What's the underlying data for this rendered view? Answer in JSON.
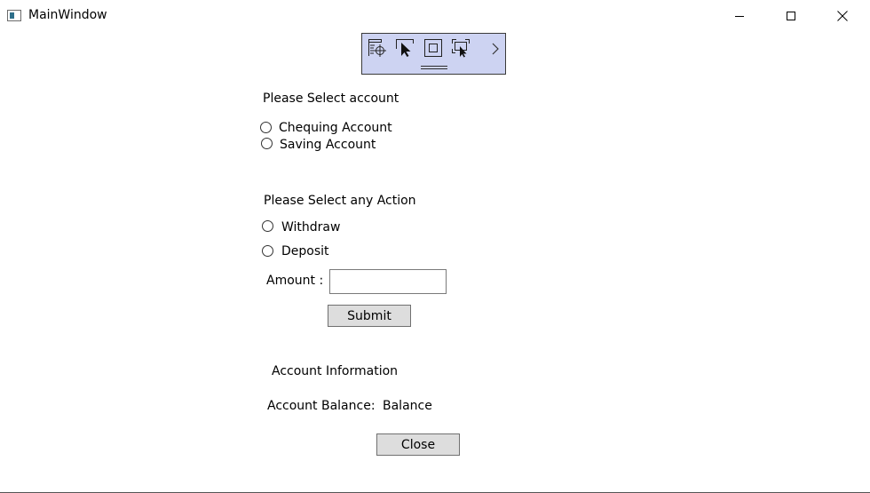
{
  "window": {
    "title": "MainWindow",
    "controls": [
      "minimize-icon",
      "maximize-icon",
      "close-icon"
    ]
  },
  "debug_toolbar": {
    "icons": [
      "select-element-icon",
      "pointer-icon",
      "display-layout-adorners-icon",
      "track-focus-icon",
      "chevron-right-icon"
    ],
    "background": "#cdd3f2"
  },
  "account_section": {
    "heading": "Please Select account",
    "options": [
      "Chequing Account",
      "Saving Account"
    ]
  },
  "action_section": {
    "heading": "Please Select any Action",
    "options": [
      "Withdraw",
      "Deposit"
    ],
    "amount_label": "Amount :",
    "amount_value": "",
    "submit_label": "Submit"
  },
  "info_section": {
    "heading": "Account Information",
    "balance_label": "Account Balance:",
    "balance_value": "Balance"
  },
  "close_label": "Close"
}
